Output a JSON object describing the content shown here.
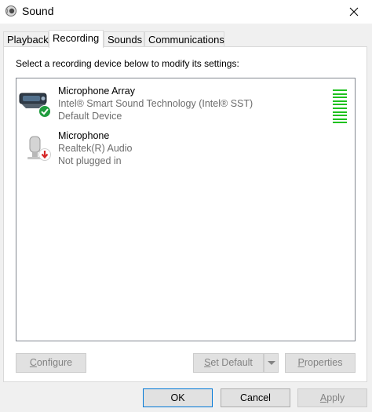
{
  "window": {
    "title": "Sound",
    "icon": "speaker-icon",
    "close_icon": "close-icon"
  },
  "tabs": [
    {
      "label": "Playback",
      "active": false
    },
    {
      "label": "Recording",
      "active": true
    },
    {
      "label": "Sounds",
      "active": false
    },
    {
      "label": "Communications",
      "active": false
    }
  ],
  "recording": {
    "instruction": "Select a recording device below to modify its settings:",
    "devices": [
      {
        "name": "Microphone Array",
        "description": "Intel® Smart Sound Technology (Intel® SST)",
        "status": "Default Device",
        "icon": "microphone-array-icon",
        "badge": "green-check-icon",
        "level_meter_bars": 10,
        "level_fill": 1.0
      },
      {
        "name": "Microphone",
        "description": "Realtek(R) Audio",
        "status": "Not plugged in",
        "icon": "microphone-icon",
        "badge": "red-down-arrow-icon"
      }
    ],
    "buttons": {
      "configure": {
        "prefix": "",
        "mnemonic": "C",
        "rest": "onfigure",
        "enabled": false
      },
      "set_default": {
        "prefix": "",
        "mnemonic": "S",
        "rest": "et Default",
        "enabled": false
      },
      "properties": {
        "prefix": "",
        "mnemonic": "P",
        "rest": "roperties",
        "enabled": false
      }
    }
  },
  "footer": {
    "ok": "OK",
    "cancel": "Cancel",
    "apply": {
      "mnemonic": "A",
      "rest": "pply",
      "enabled": false
    }
  },
  "colors": {
    "level_green": "#1ec11e",
    "primary_border": "#0078d7",
    "disabled_text": "#838383"
  }
}
